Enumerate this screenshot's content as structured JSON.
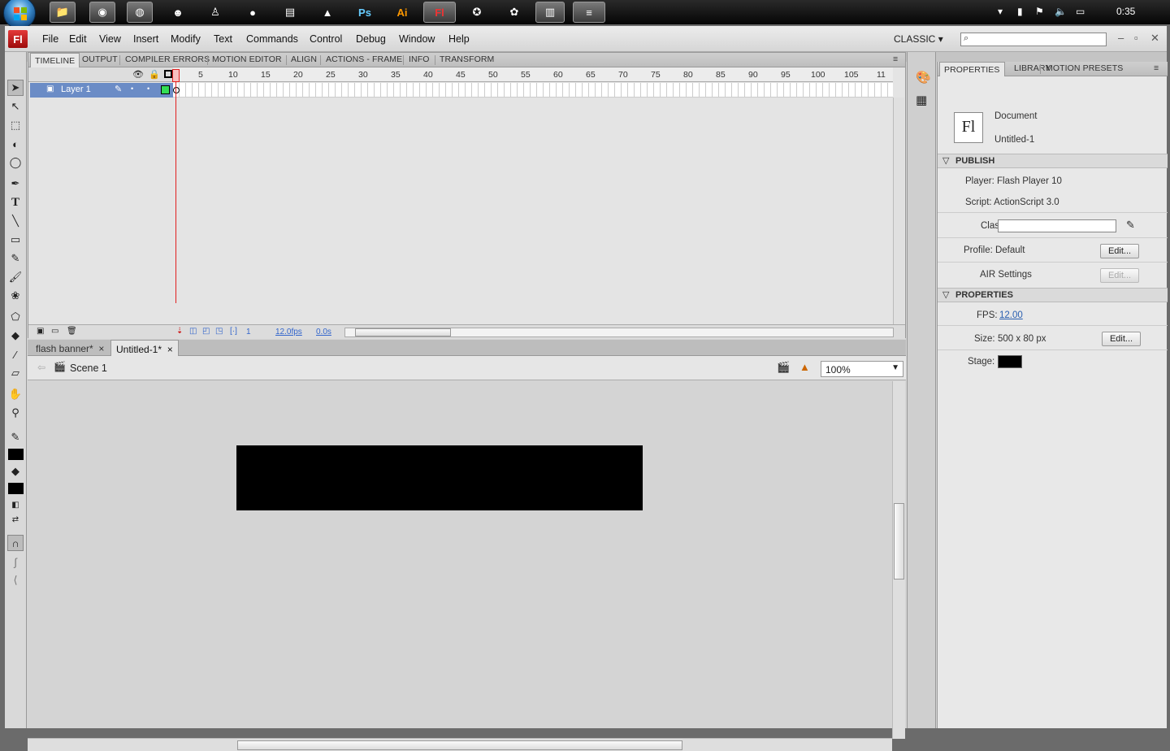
{
  "taskbar": {
    "clock": "0:35"
  },
  "menu": [
    "File",
    "Edit",
    "View",
    "Insert",
    "Modify",
    "Text",
    "Commands",
    "Control",
    "Debug",
    "Window",
    "Help"
  ],
  "app": {
    "logo": "Fl",
    "workspace": "CLASSIC"
  },
  "timeline_tabs": [
    "TIMELINE",
    "OUTPUT",
    "COMPILER ERRORS",
    "MOTION EDITOR",
    "ALIGN",
    "ACTIONS - FRAME",
    "INFO",
    "TRANSFORM"
  ],
  "timeline": {
    "layer_name": "Layer 1",
    "ruler": [
      "1",
      "5",
      "10",
      "15",
      "20",
      "25",
      "30",
      "35",
      "40",
      "45",
      "50",
      "55",
      "60",
      "65",
      "70",
      "75",
      "80",
      "85",
      "90",
      "95",
      "100",
      "105",
      "11"
    ],
    "current_frame": "1",
    "fps": "12.0fps",
    "elapsed": "0.0s"
  },
  "doc_tabs": [
    {
      "label": "flash banner*",
      "close": "×"
    },
    {
      "label": "Untitled-1*",
      "close": "×"
    }
  ],
  "edit_bar": {
    "scene": "Scene 1",
    "zoom": "100%"
  },
  "properties": {
    "tabs": [
      "PROPERTIES",
      "LIBRARY",
      "MOTION PRESETS"
    ],
    "doc_type": "Document",
    "doc_name": "Untitled-1",
    "publish_header": "PUBLISH",
    "player": "Player: Flash Player 10",
    "script": "Script: ActionScript 3.0",
    "class_label": "Class:",
    "profile": "Profile: Default",
    "air": "AIR Settings",
    "edit_btn": "Edit...",
    "properties_header": "PROPERTIES",
    "fps_label": "FPS:",
    "fps_value": "12.00",
    "size_label": "Size:",
    "size_value": "500 x 80 px",
    "stage_label": "Stage:",
    "stage_color": "#000000"
  }
}
